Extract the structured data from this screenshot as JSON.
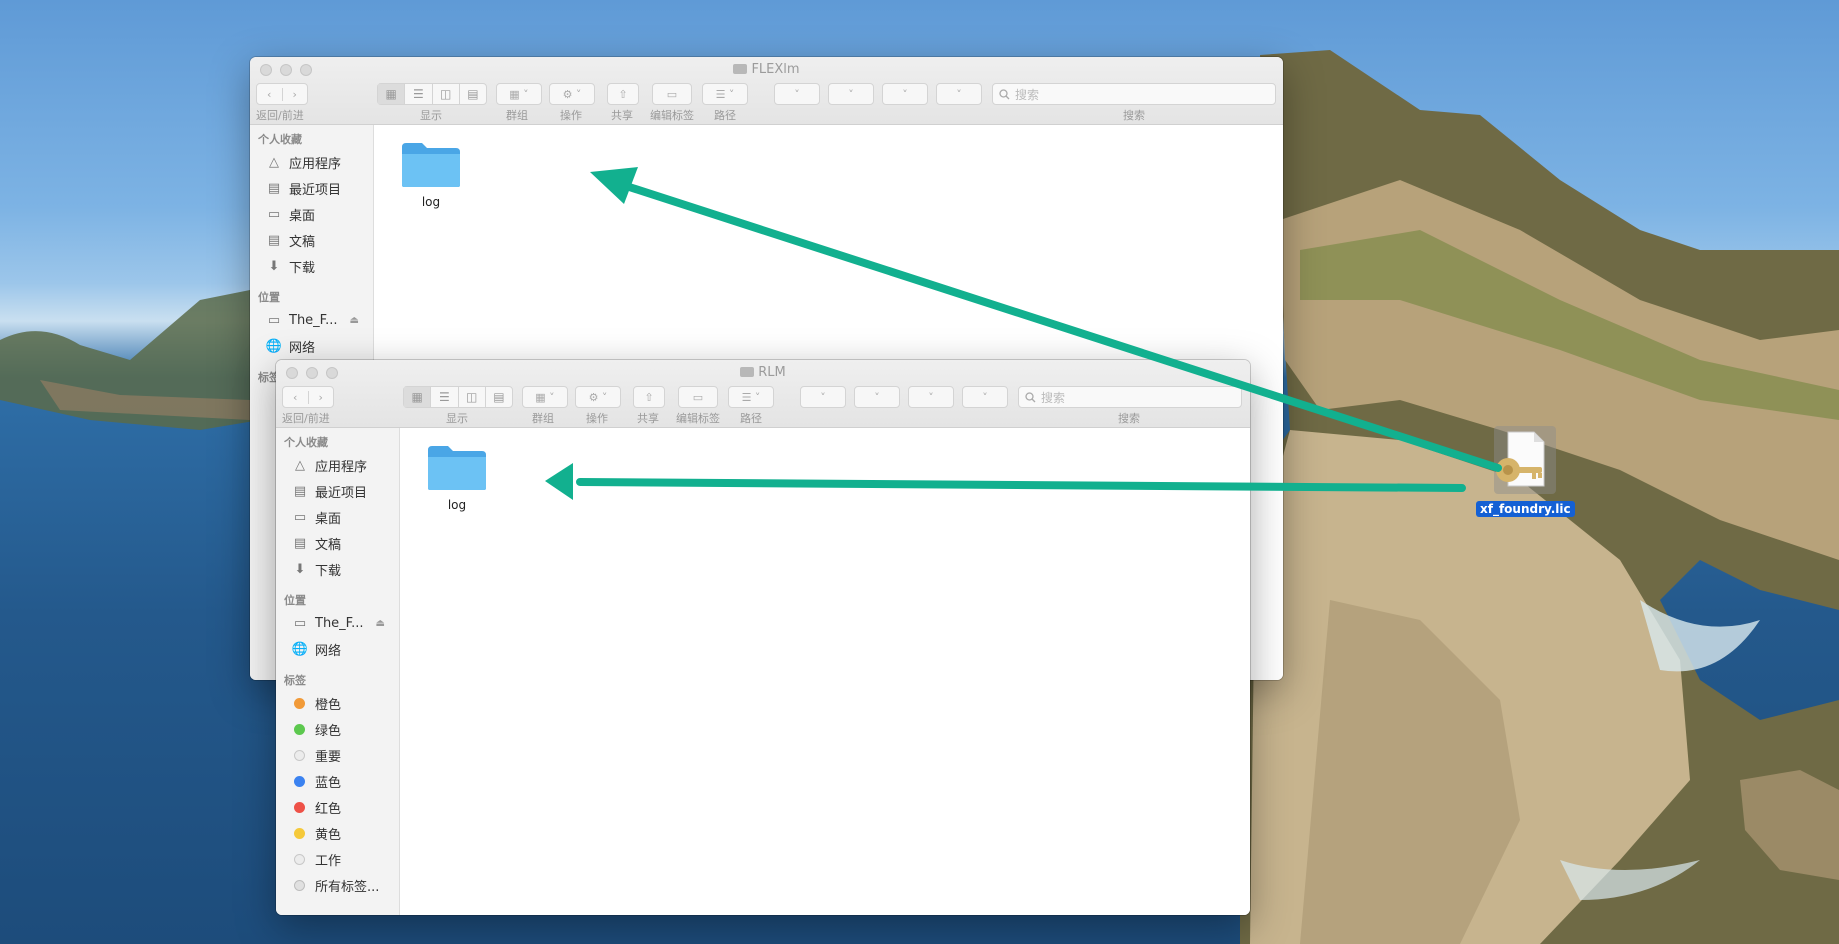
{
  "desktop": {
    "file": {
      "name": "xf_foundry.lic"
    }
  },
  "windows": [
    {
      "id": "flexlm",
      "title": "FLEXlm",
      "toolbar": {
        "nav_label": "返回/前进",
        "view_label": "显示",
        "group_label": "群组",
        "action_label": "操作",
        "share_label": "共享",
        "tags_label": "编辑标签",
        "path_label": "路径",
        "search_label": "搜索",
        "search_placeholder": "搜索"
      },
      "sidebar": {
        "favorites_header": "个人收藏",
        "favorites": [
          "应用程序",
          "最近项目",
          "桌面",
          "文稿",
          "下载"
        ],
        "locations_header": "位置",
        "locations": [
          "The_F...",
          "网络"
        ],
        "tags_header": "标签"
      },
      "items": [
        {
          "name": "log",
          "kind": "folder"
        }
      ]
    },
    {
      "id": "rlm",
      "title": "RLM",
      "toolbar": {
        "nav_label": "返回/前进",
        "view_label": "显示",
        "group_label": "群组",
        "action_label": "操作",
        "share_label": "共享",
        "tags_label": "编辑标签",
        "path_label": "路径",
        "search_label": "搜索",
        "search_placeholder": "搜索"
      },
      "sidebar": {
        "favorites_header": "个人收藏",
        "favorites": [
          "应用程序",
          "最近项目",
          "桌面",
          "文稿",
          "下载"
        ],
        "locations_header": "位置",
        "locations": [
          "The_F...",
          "网络"
        ],
        "tags_header": "标签",
        "tags": [
          {
            "label": "橙色",
            "color": "#f19a38"
          },
          {
            "label": "绿色",
            "color": "#5cc84e"
          },
          {
            "label": "重要",
            "color": "#e4e4e4"
          },
          {
            "label": "蓝色",
            "color": "#3b82f0"
          },
          {
            "label": "红色",
            "color": "#ee5147"
          },
          {
            "label": "黄色",
            "color": "#f5c93a"
          },
          {
            "label": "工作",
            "color": "#e4e4e4"
          },
          {
            "label": "所有标签...",
            "color": "#d8d8d8"
          }
        ]
      },
      "items": [
        {
          "name": "log",
          "kind": "folder"
        }
      ]
    }
  ],
  "colors": {
    "arrow": "#12b08f",
    "selection": "#1460d4",
    "folder": "#5bb8f0"
  }
}
